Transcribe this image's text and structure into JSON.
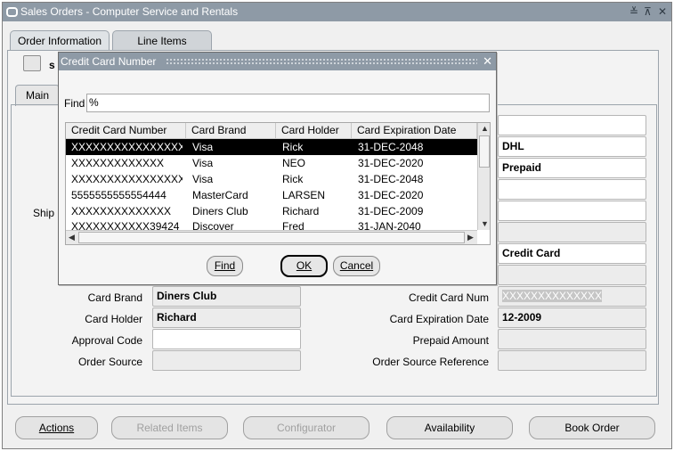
{
  "window": {
    "title": "Sales Orders - Computer Service and Rentals",
    "controls": [
      "≚",
      "⊼",
      "✕"
    ]
  },
  "tabs": [
    {
      "label": "Order Information"
    },
    {
      "label": "Line Items"
    }
  ],
  "toolbar": {
    "visible_letter": "s"
  },
  "subtabs": {
    "main": "Main"
  },
  "partial_labels": {
    "ship": "Ship"
  },
  "fields_right_top": [
    {
      "value": ""
    },
    {
      "value": "DHL"
    },
    {
      "value": "Prepaid"
    },
    {
      "value": ""
    },
    {
      "value": ""
    },
    {
      "value": ""
    },
    {
      "value": "Credit Card"
    },
    {
      "value": ""
    }
  ],
  "form": {
    "card_brand": {
      "label": "Card Brand",
      "value": "Diners Club"
    },
    "card_holder": {
      "label": "Card Holder",
      "value": "Richard"
    },
    "approval_code": {
      "label": "Approval Code",
      "value": ""
    },
    "order_source": {
      "label": "Order Source",
      "value": ""
    },
    "credit_card_num": {
      "label": "Credit Card Num",
      "value": "XXXXXXXXXXXXXX"
    },
    "card_expiration": {
      "label": "Card Expiration Date",
      "value": "12-2009"
    },
    "prepaid_amount": {
      "label": "Prepaid Amount",
      "value": ""
    },
    "order_source_ref": {
      "label": "Order Source Reference",
      "value": ""
    }
  },
  "buttons": {
    "actions": "Actions",
    "related_items": "Related Items",
    "configurator": "Configurator",
    "availability": "Availability",
    "book_order": "Book Order"
  },
  "dialog": {
    "title": "Credit Card Number",
    "close": "✕",
    "find_label": "Find",
    "find_value": "%",
    "columns": [
      "Credit Card Number",
      "Card Brand",
      "Card Holder",
      "Card Expiration Date"
    ],
    "rows": [
      [
        "XXXXXXXXXXXXXXXX",
        "Visa",
        "Rick",
        "31-DEC-2048"
      ],
      [
        "XXXXXXXXXXXXX",
        "Visa",
        "NEO",
        "31-DEC-2020"
      ],
      [
        "XXXXXXXXXXXXXXXX",
        "Visa",
        "Rick",
        "31-DEC-2048"
      ],
      [
        "5555555555554444",
        "MasterCard",
        "LARSEN",
        "31-DEC-2020"
      ],
      [
        "XXXXXXXXXXXXXX",
        "Diners Club",
        "Richard",
        "31-DEC-2009"
      ],
      [
        "XXXXXXXXXXX39424",
        "Discover",
        "Fred",
        "31-JAN-2040"
      ]
    ],
    "buttons": {
      "find": "Find",
      "ok": "OK",
      "cancel": "Cancel"
    }
  }
}
